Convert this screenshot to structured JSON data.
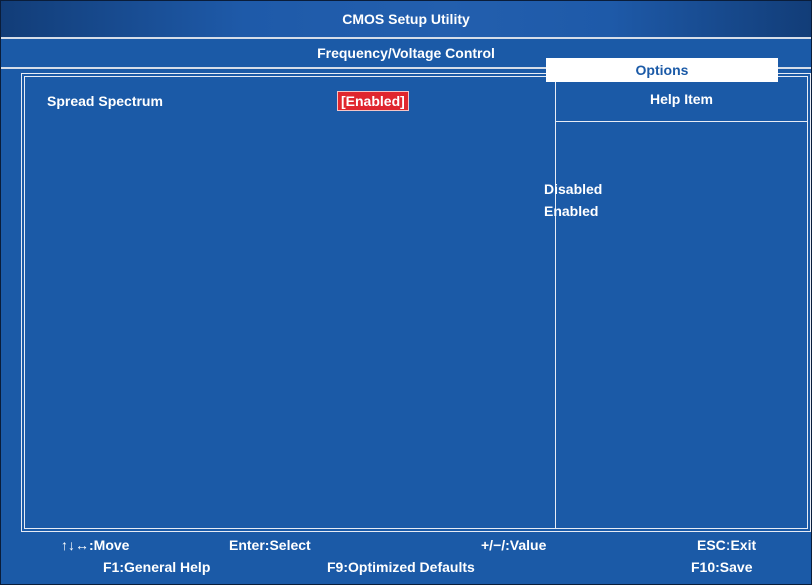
{
  "title": "CMOS Setup Utility",
  "subtitle": "Frequency/Voltage Control",
  "settings": [
    {
      "label": "Spread Spectrum",
      "value": "[Enabled]"
    }
  ],
  "help": {
    "title": "Help Item",
    "options_header": "Options",
    "options": [
      "Disabled",
      "Enabled"
    ]
  },
  "footer": {
    "move": ":Move",
    "enter": "Enter:Select",
    "value": "+/−/:Value",
    "esc": "ESCːExit",
    "f1": "F1:General Help",
    "f9": "F9:Optimized Defaults",
    "f10": "F10:Save"
  },
  "colors": {
    "background": "#1b5aa7",
    "highlight": "#e0262e",
    "text": "#ffffff"
  }
}
